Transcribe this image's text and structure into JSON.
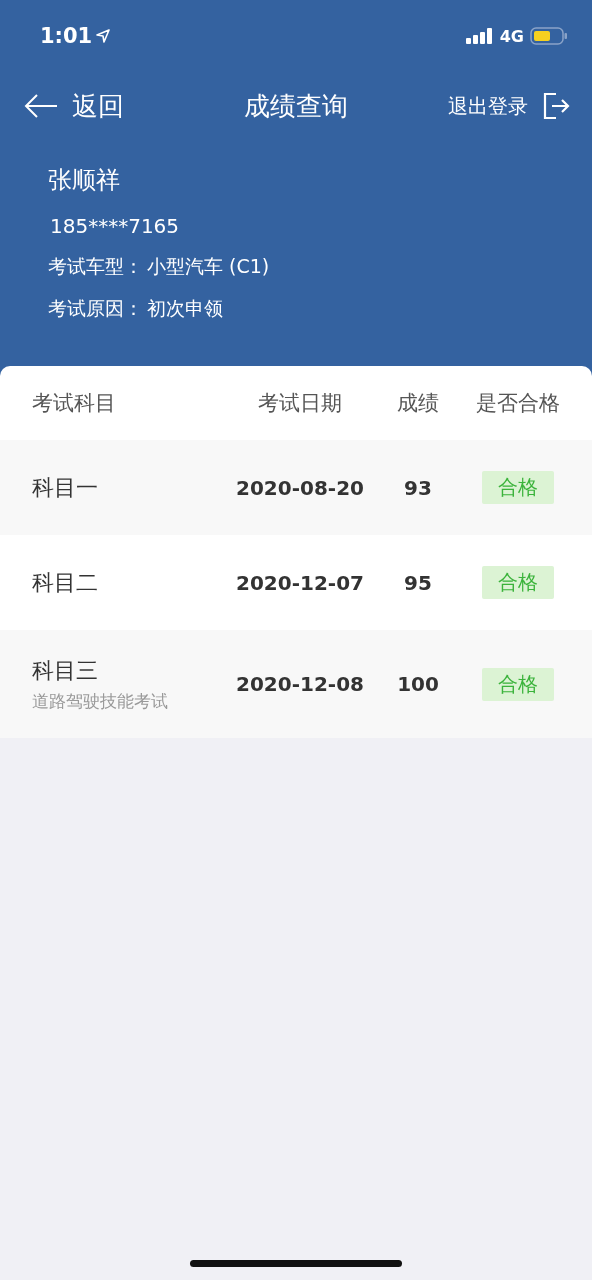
{
  "status_bar": {
    "time": "1:01",
    "network": "4G"
  },
  "nav": {
    "back": "返回",
    "title": "成绩查询",
    "logout": "退出登录"
  },
  "profile": {
    "name": "张顺祥",
    "phone": "185****7165",
    "fields": [
      {
        "label": "考试车型：",
        "value": "小型汽车 (C1)"
      },
      {
        "label": "考试原因：",
        "value": "初次申领"
      }
    ]
  },
  "table": {
    "columns": [
      "考试科目",
      "考试日期",
      "成绩",
      "是否合格"
    ],
    "rows": [
      {
        "subject": "科目一",
        "date": "2020-08-20",
        "score": "93",
        "result": "合格"
      },
      {
        "subject": "科目二",
        "date": "2020-12-07",
        "score": "95",
        "result": "合格"
      },
      {
        "subject": "科目三",
        "note": "道路驾驶技能考试",
        "date": "2020-12-08",
        "score": "100",
        "result": "合格"
      }
    ]
  }
}
